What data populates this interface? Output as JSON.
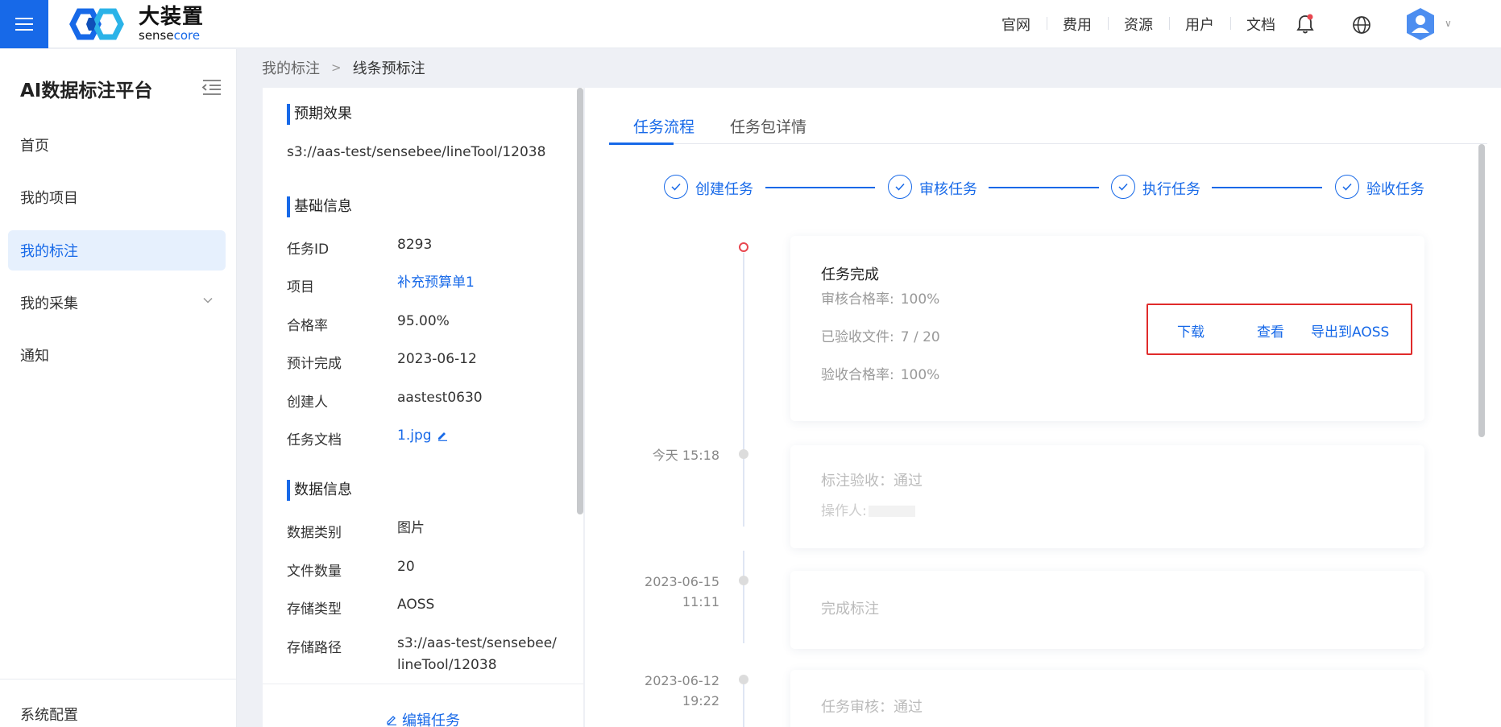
{
  "header": {
    "brand_cn": "大装置",
    "brand_en_a": "sense",
    "brand_en_b": "core",
    "nav": [
      "官网",
      "费用",
      "资源",
      "用户",
      "文档"
    ],
    "notification_dot_color": "#e8464f"
  },
  "sidebar": {
    "title": "AI数据标注平台",
    "items": [
      {
        "label": "首页"
      },
      {
        "label": "我的项目"
      },
      {
        "label": "我的标注",
        "active": true
      },
      {
        "label": "我的采集",
        "expandable": true
      },
      {
        "label": "通知"
      }
    ],
    "footer": "系统配置"
  },
  "breadcrumb": {
    "parent": "我的标注",
    "current": "线条预标注"
  },
  "info": {
    "expected_title": "预期效果",
    "expected_path": "s3://aas-test/sensebee/lineTool/12038",
    "basic_title": "基础信息",
    "basic": [
      {
        "k": "任务ID",
        "v": "8293"
      },
      {
        "k": "项目",
        "v": "补充预算单1"
      },
      {
        "k": "合格率",
        "v": "95.00%"
      },
      {
        "k": "预计完成",
        "v": "2023-06-12"
      },
      {
        "k": "创建人",
        "v": "aastest0630"
      },
      {
        "k": "任务文档",
        "v": "1.jpg"
      }
    ],
    "data_title": "数据信息",
    "data": [
      {
        "k": "数据类别",
        "v": "图片"
      },
      {
        "k": "文件数量",
        "v": "20"
      },
      {
        "k": "存储类型",
        "v": "AOSS"
      },
      {
        "k": "存储路径",
        "v": "s3://aas-test/sensebee/lineTool/12038"
      }
    ],
    "edit_task": "编辑任务"
  },
  "main": {
    "tabs": [
      "任务流程",
      "任务包详情"
    ],
    "steps": [
      "创建任务",
      "审核任务",
      "执行任务",
      "验收任务"
    ],
    "timeline": [
      {
        "title": "任务完成",
        "rows": [
          {
            "k": "审核合格率:",
            "v": "100%"
          },
          {
            "k": "已验收文件:",
            "v": "7 / 20"
          },
          {
            "k": "验收合格率:",
            "v": "100%"
          }
        ],
        "actions": [
          "下载",
          "查看",
          "导出到AOSS"
        ]
      },
      {
        "time": "今天 15:18",
        "title": "标注验收：通过",
        "sub": "操作人:"
      },
      {
        "time_date": "2023-06-15",
        "time_clock": "11:11",
        "title": "完成标注"
      },
      {
        "time_date": "2023-06-12",
        "time_clock": "19:22",
        "title": "任务审核：通过"
      }
    ]
  }
}
